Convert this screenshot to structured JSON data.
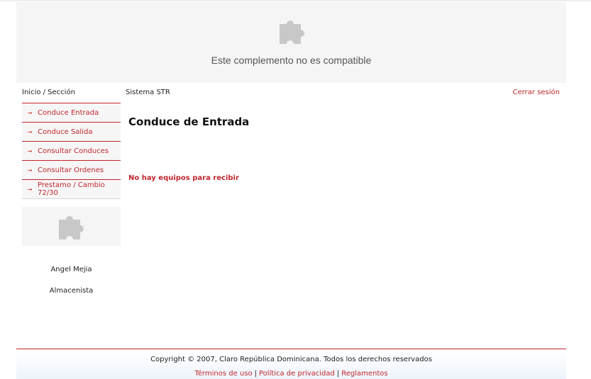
{
  "plugin_banner": {
    "message": "Este complemento no es compatible",
    "icon": "puzzle-piece-icon"
  },
  "header": {
    "breadcrumb": "Inicio / Sección",
    "system_name": "Sistema STR",
    "logout_label": "Cerrar sesión"
  },
  "menu": {
    "items": [
      {
        "label": "Conduce Entrada"
      },
      {
        "label": "Conduce Salida"
      },
      {
        "label": "Consultar Conduces"
      },
      {
        "label": "Consultar Ordenes"
      },
      {
        "label": "Prestamo / Cambio 72/30"
      }
    ]
  },
  "side_plugin": {
    "icon": "puzzle-piece-icon"
  },
  "user": {
    "name": "Angel Mejia",
    "role": "Almacenista"
  },
  "main": {
    "title": "Conduce de Entrada",
    "empty_message": "No hay equipos para recibir"
  },
  "footer": {
    "copyright": "Copyright © 2007, Claro República Dominicana. Todos los derechos reservados",
    "links": [
      "Términos de uso",
      "Política de privacidad",
      "Reglamentos"
    ]
  },
  "colors": {
    "accent": "#c0262c",
    "panel_bg": "#f5f5f5",
    "footer_gradient_end": "#eef4fb"
  }
}
